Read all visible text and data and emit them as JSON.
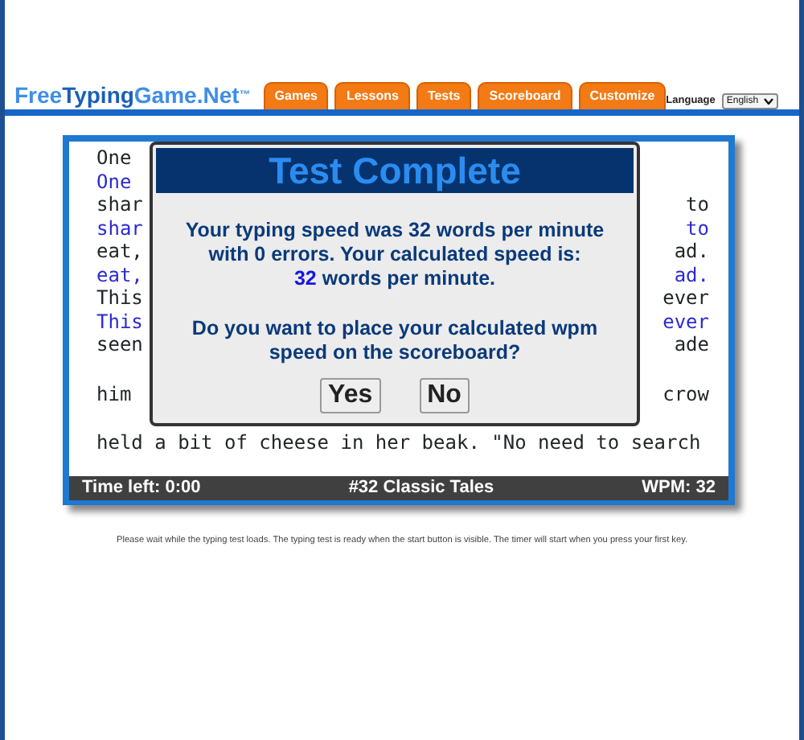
{
  "logo": [
    {
      "text": "Free",
      "color": "#3d8ee6"
    },
    {
      "text": "Typing",
      "color": "#1a5fb4"
    },
    {
      "text": "Game.Net$^{™}$",
      "color": "#3d8ee6"
    }
  ],
  "tabs": [
    {
      "label": "Games",
      "selected": false
    },
    {
      "label": "Lessons",
      "selected": false
    },
    {
      "label": "Tests",
      "selected": false
    },
    {
      "label": "Scoreboard",
      "selected": false
    },
    {
      "label": "Customize",
      "selected": false
    }
  ],
  "language": {
    "label": "Language",
    "value": "English"
  },
  "text_lines": [
    {
      "kind": "source",
      "left": "One"
    },
    {
      "kind": "typed",
      "left": "One"
    },
    {
      "kind": "source",
      "left": "shar",
      "right": "to"
    },
    {
      "kind": "typed",
      "left": "shar",
      "right": "to"
    },
    {
      "kind": "source",
      "left": "eat,",
      "right": "ad."
    },
    {
      "kind": "typed",
      "left": "eat,",
      "right": "ad."
    },
    {
      "kind": "source",
      "left": "This",
      "right": "ever"
    },
    {
      "kind": "typed",
      "left": "This",
      "right": "ever"
    },
    {
      "kind": "source",
      "left": "seen",
      "right": "ade"
    },
    {
      "kind": "gap"
    },
    {
      "kind": "source",
      "left": "him",
      "right": "crow"
    },
    {
      "kind": "gap"
    },
    {
      "kind": "source",
      "left": "held a bit of cheese in her beak. \"No need to search"
    }
  ],
  "status_bar": {
    "time_left": "Time left: 0:00",
    "title": "#32 Classic Tales",
    "wpm": "WPM: 32"
  },
  "dialog": {
    "title": "Test Complete",
    "message": "Your typing speed was 32 words per minute with 0 errors. Your calculated speed is:",
    "speed_value": "32",
    "speed_unit": "words per minute.",
    "question": "Do you want to place your calculated wpm speed on the scoreboard?",
    "buttons": [
      "Yes",
      "No"
    ]
  },
  "footer": "Please wait while the typing test loads. The typing test is ready when the start button is visible. The timer will start when you press your first key."
}
